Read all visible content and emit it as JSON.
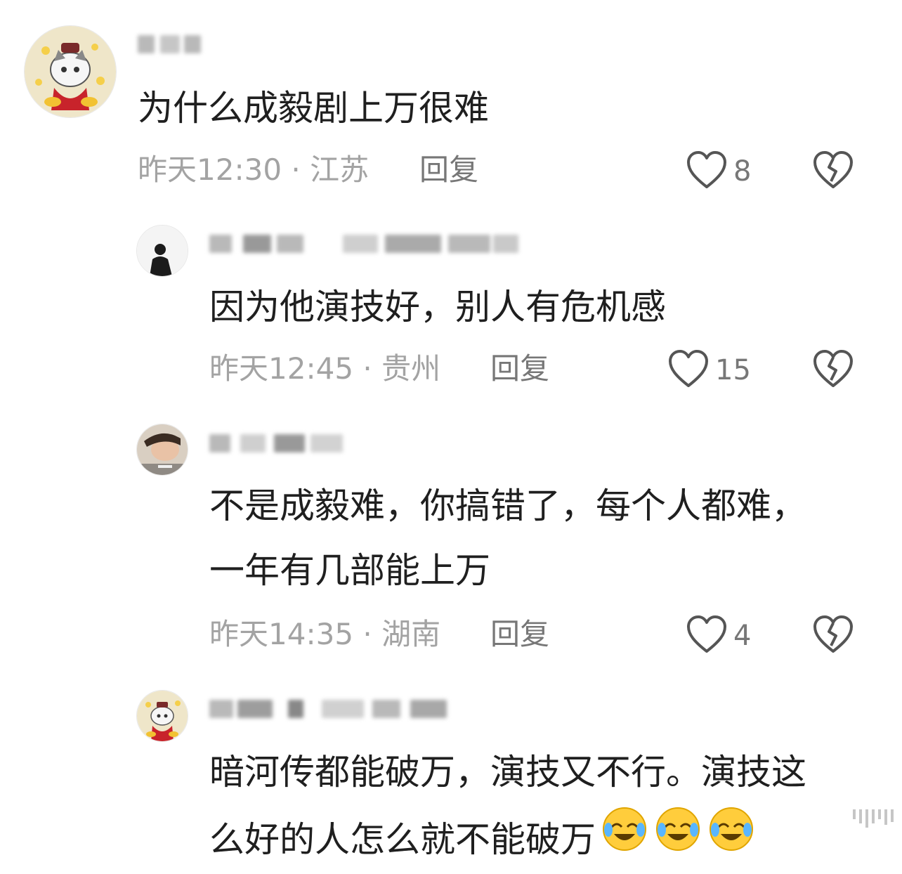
{
  "comments": [
    {
      "content_lines": [
        "为什么成毅剧上万很难"
      ],
      "time_location": "昨天12:30 · 江苏",
      "reply_label": "回复",
      "likes": "8"
    },
    {
      "content_lines": [
        "因为他演技好，别人有危机感"
      ],
      "time_location": "昨天12:45 · 贵州",
      "reply_label": "回复",
      "likes": "15"
    },
    {
      "content_lines": [
        "不是成毅难，你搞错了，每个人都难，",
        "一年有几部能上万"
      ],
      "time_location": "昨天14:35 · 湖南",
      "reply_label": "回复",
      "likes": "4"
    },
    {
      "content_lines": [
        "暗河传都能破万，演技又不行。演技这",
        "么好的人怎么就不能破万"
      ]
    }
  ],
  "icons": {
    "like": "heart-outline-icon",
    "dislike": "broken-heart-icon",
    "emoji": "laughing-crying-emoji"
  },
  "colors": {
    "text": "#1f1f1f",
    "meta": "#a3a3a3",
    "icon": "#555555"
  }
}
